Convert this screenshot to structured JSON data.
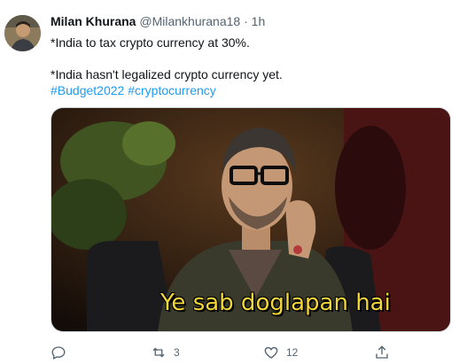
{
  "author": {
    "name": "Milan Khurana",
    "handle": "@Milankhurana18",
    "separator": "·",
    "time": "1h"
  },
  "tweet": {
    "line1": "*India to tax crypto currency at 30%.",
    "line2": "*India hasn't legalized crypto currency yet.",
    "hashtags": [
      "#Budget2022",
      "#cryptocurrency"
    ]
  },
  "media": {
    "caption": "Ye sab doglapan hai"
  },
  "actions": {
    "reply_icon": "reply-icon",
    "retweet_icon": "retweet-icon",
    "retweet_count": "3",
    "like_icon": "heart-icon",
    "like_count": "12",
    "share_icon": "share-icon"
  },
  "colors": {
    "link": "#1d9bf0",
    "muted": "#536471",
    "caption": "#f2d63a"
  }
}
